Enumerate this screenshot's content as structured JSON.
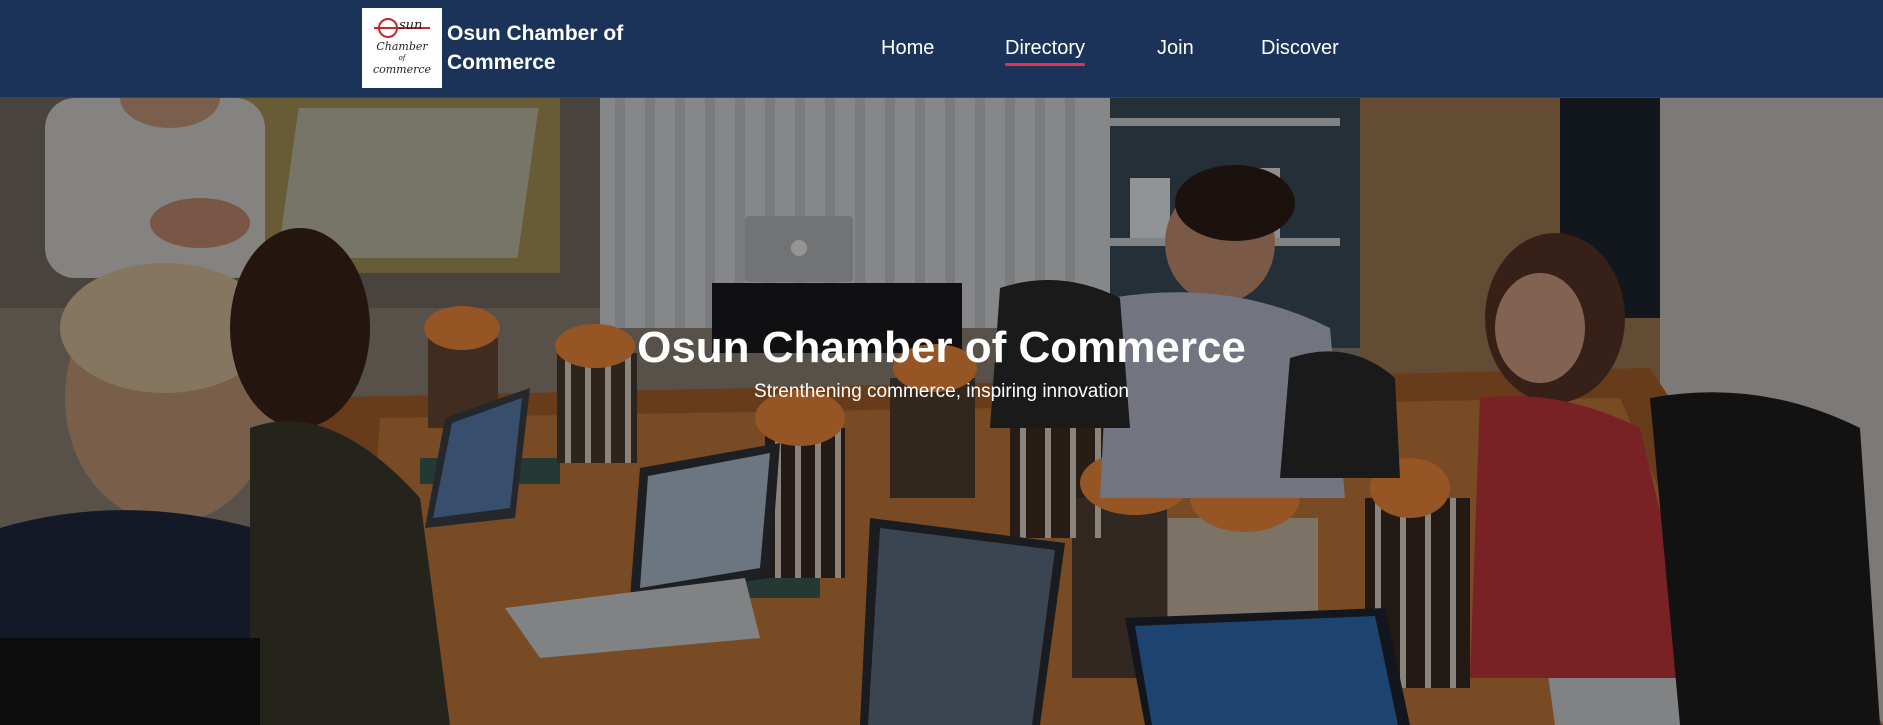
{
  "header": {
    "logo": {
      "wordmark_first": "O",
      "wordmark_rest": "sun",
      "line1": "Chamber",
      "line2": "of",
      "line3": "commerce"
    },
    "brand_name": "Osun Chamber of Commerce",
    "nav": {
      "home": "Home",
      "directory": "Directory",
      "join": "Join",
      "discover": "Discover",
      "active": "Directory",
      "active_color": "#e0344a"
    },
    "background_color": "#1b3358"
  },
  "hero": {
    "title": "Osun Chamber of Commerce",
    "subtitle": "Strenthening commerce, inspiring innovation",
    "image": "business-meeting-photo"
  }
}
